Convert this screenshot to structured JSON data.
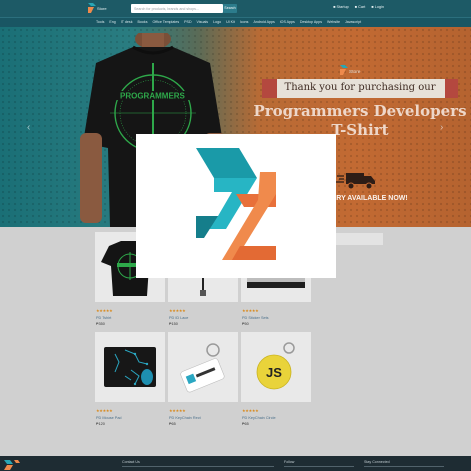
{
  "header": {
    "brand_text": "Store",
    "search_placeholder": "Search for products, brands and shops...",
    "search_button": "Search",
    "links": [
      "Startup",
      "Cart",
      "Login"
    ]
  },
  "nav": {
    "items": [
      "Tools",
      "Eng",
      "IT desk",
      "Books",
      "Office Templates",
      "PSD",
      "Visuals",
      "Logo",
      "UI Kit",
      "Icons",
      "Android Apps",
      "iOS Apps",
      "Desktop Apps",
      "Website",
      "Javascript"
    ]
  },
  "banner": {
    "brand_text": "Store",
    "thanks": "Thank you for purchasing our",
    "title_line1": "Programmers Developers",
    "title_line2": "T-Shirt",
    "delivery": "IVERY AVAILABLE NOW!",
    "shirt_text": "PROGRAMMERS"
  },
  "products": [
    {
      "name": "PD Tshirt",
      "price": "₱350",
      "rating": "★★★★★"
    },
    {
      "name": "PD ID Lace",
      "price": "₱150",
      "rating": "★★★★★"
    },
    {
      "name": "PD Sticker Sets",
      "price": "₱50",
      "rating": "★★★★★"
    },
    {
      "name": "PD Mouse Pad",
      "price": "₱120",
      "rating": "★★★★★"
    },
    {
      "name": "PD KeyChain Rect",
      "price": "₱65",
      "rating": "★★★★★"
    },
    {
      "name": "PD KeyChain Circle",
      "price": "₱65",
      "rating": "★★★★★"
    }
  ],
  "keychain_circle_text": "JS",
  "footer": {
    "col1": "Contact Us",
    "col2": "Follow",
    "col3": "Stay Connected"
  },
  "colors": {
    "topbar": "#1d5a66",
    "accent_teal": "#1a9aa8",
    "accent_orange": "#ef8a4c",
    "ribbon": "#b4483f"
  },
  "icons": [
    "store-logo-icon",
    "user-icon",
    "cart-icon",
    "login-icon",
    "truck-icon",
    "chevron-left-icon",
    "chevron-right-icon",
    "pd-loading-logo-icon"
  ]
}
